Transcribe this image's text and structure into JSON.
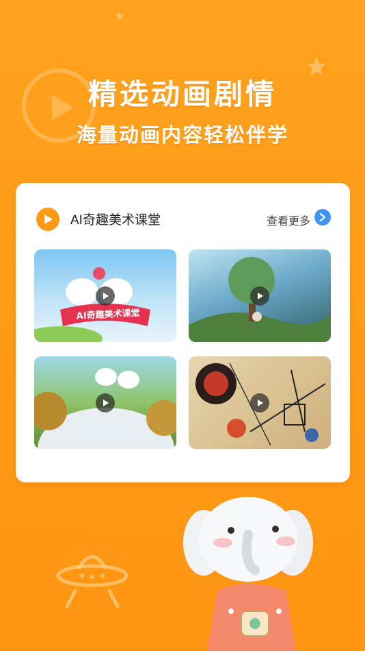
{
  "promo": {
    "headline": "精选动画剧情",
    "subheadline": "海量动画内容轻松伴学"
  },
  "section": {
    "title": "AI奇趣美术课堂",
    "more_label": "查看更多"
  },
  "videos": [
    {
      "banner_text": "AI奇趣美术课堂"
    },
    {},
    {},
    {}
  ],
  "colors": {
    "background": "#FFA21E",
    "accent_orange": "#FF9A14",
    "link_blue": "#3F94F2"
  }
}
